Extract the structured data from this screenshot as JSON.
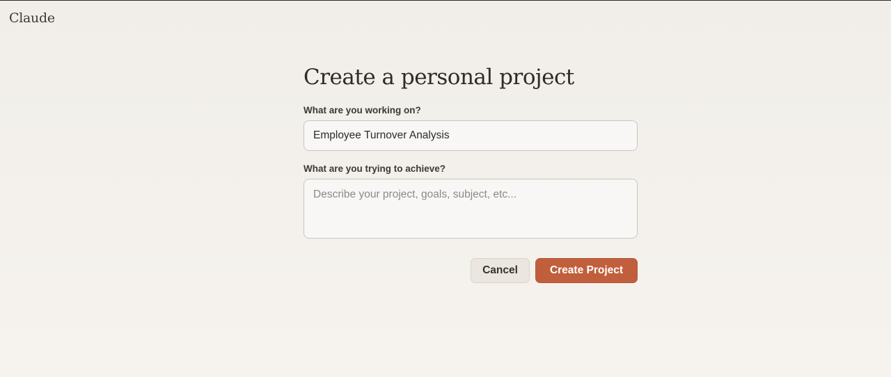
{
  "app": {
    "logo_text": "Claude"
  },
  "form": {
    "title": "Create a personal project",
    "name_label": "What are you working on?",
    "name_value": "Employee Turnover Analysis",
    "goal_label": "What are you trying to achieve?",
    "goal_value": "",
    "goal_placeholder": "Describe your project, goals, subject, etc..."
  },
  "actions": {
    "cancel_label": "Cancel",
    "create_label": "Create Project"
  },
  "colors": {
    "accent": "#c15f3c",
    "background": "#f2efea"
  }
}
